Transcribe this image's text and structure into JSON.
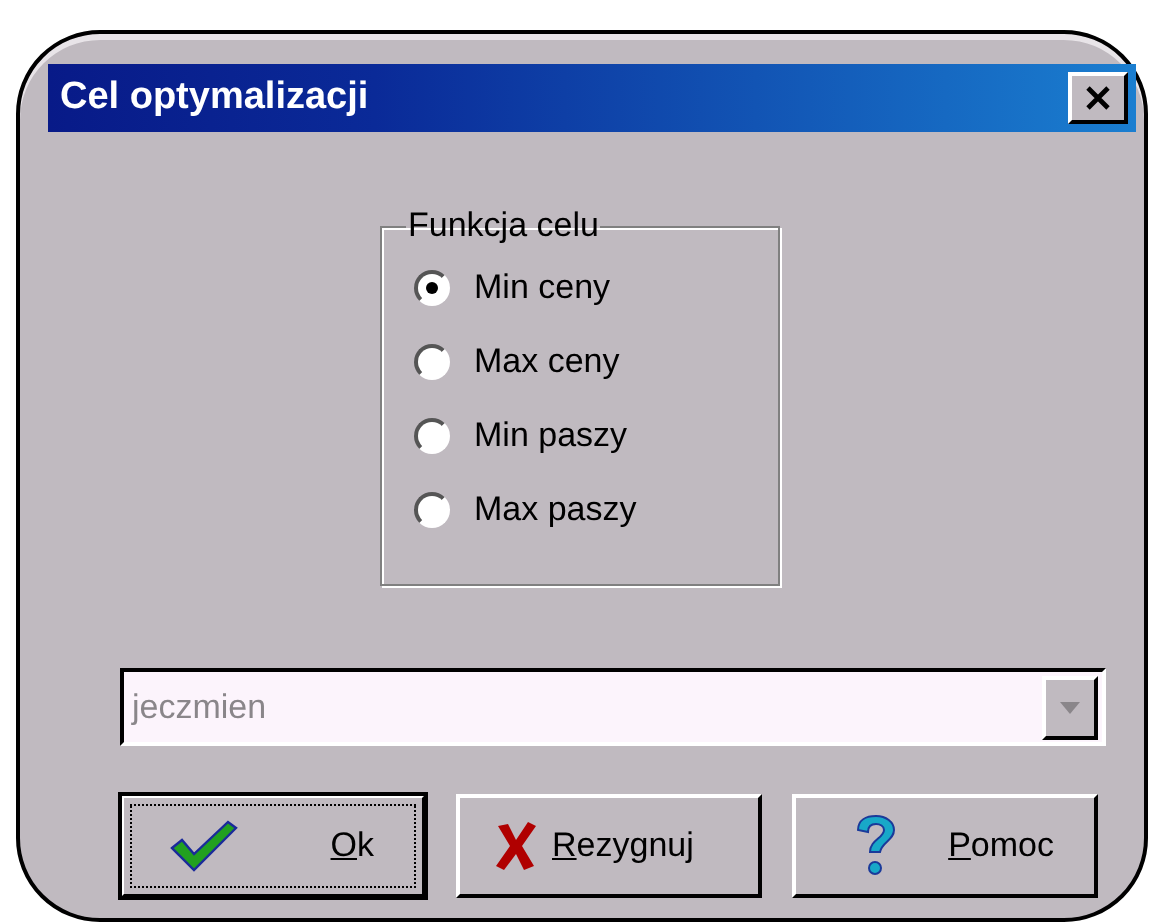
{
  "window": {
    "title": "Cel optymalizacji"
  },
  "group": {
    "label": "Funkcja celu",
    "options": [
      {
        "label": "Min ceny",
        "selected": true
      },
      {
        "label": "Max ceny",
        "selected": false
      },
      {
        "label": "Min paszy",
        "selected": false
      },
      {
        "label": "Max paszy",
        "selected": false
      }
    ]
  },
  "combo": {
    "value": "jeczmien",
    "disabled": true
  },
  "buttons": [
    {
      "kind": "ok",
      "label": "Ok",
      "default": true,
      "mnemonic_underlined": true
    },
    {
      "kind": "cancel",
      "label": "Rezygnuj",
      "default": false,
      "mnemonic_underlined": true
    },
    {
      "kind": "help",
      "label": "Pomoc",
      "default": false,
      "mnemonic_underlined": true
    }
  ]
}
